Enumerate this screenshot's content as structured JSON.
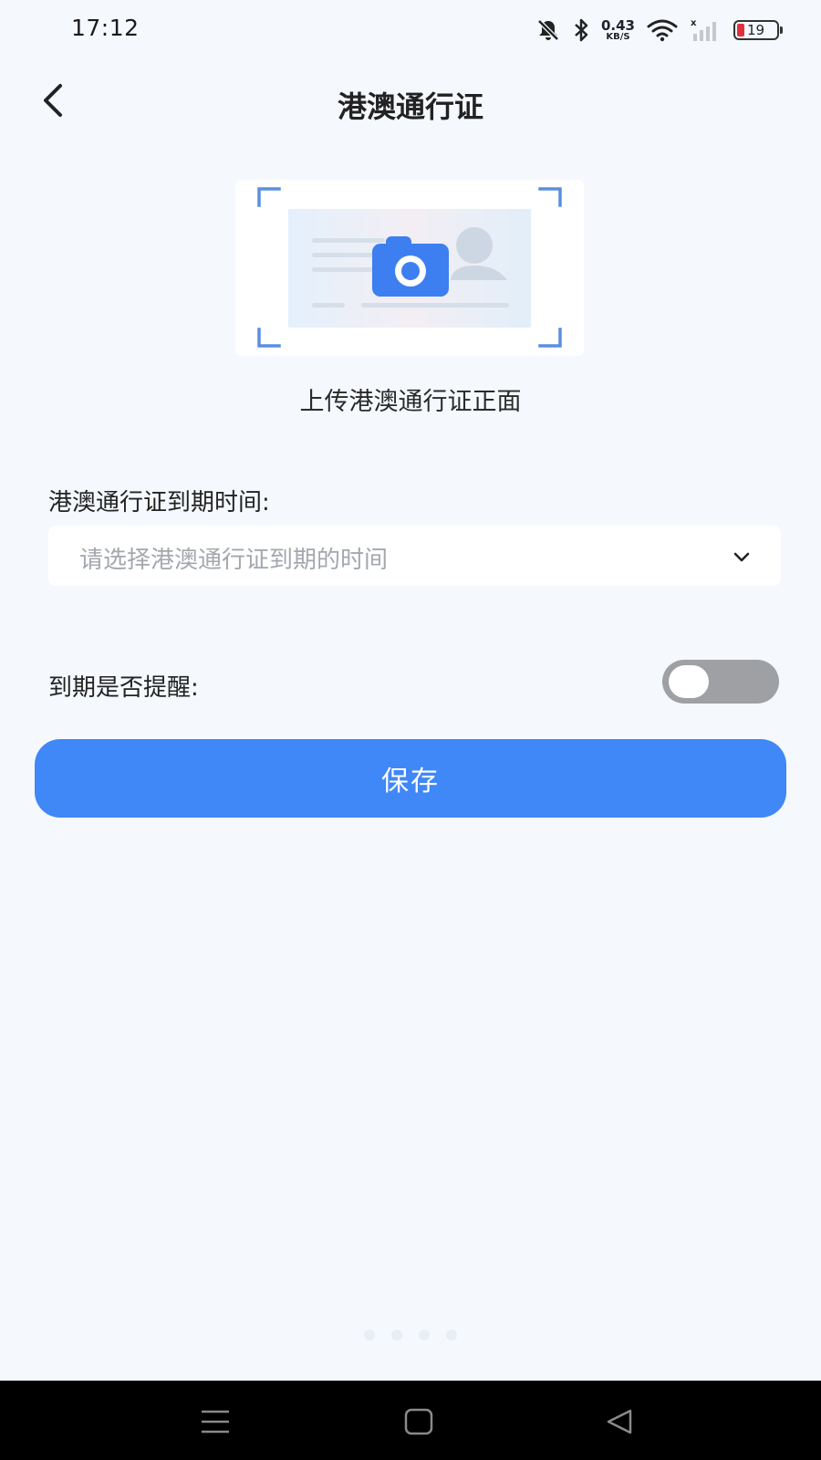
{
  "status_bar": {
    "time": "17:12",
    "net_speed_value": "0.43",
    "net_speed_unit": "KB/S",
    "battery_level": "19",
    "icons": [
      "mute-bell-icon",
      "bluetooth-icon",
      "wifi-icon",
      "signal-icon",
      "battery-icon"
    ]
  },
  "header": {
    "title": "港澳通行证",
    "back_icon": "chevron-left-icon"
  },
  "upload": {
    "caption": "上传港澳通行证正面",
    "icon": "camera-icon"
  },
  "expiry": {
    "label": "港澳通行证到期时间:",
    "placeholder": "请选择港澳通行证到期的时间",
    "icon": "chevron-down-icon"
  },
  "reminder": {
    "label": "到期是否提醒:",
    "enabled": false
  },
  "save_button": {
    "label": "保存"
  },
  "nav_bar": {
    "icons": [
      "menu-icon",
      "home-icon",
      "back-triangle-icon"
    ]
  },
  "colors": {
    "accent": "#4087f7",
    "background": "#f5f9fe",
    "toggle_off": "#9ea0a4",
    "battery_low": "#e0313b"
  }
}
